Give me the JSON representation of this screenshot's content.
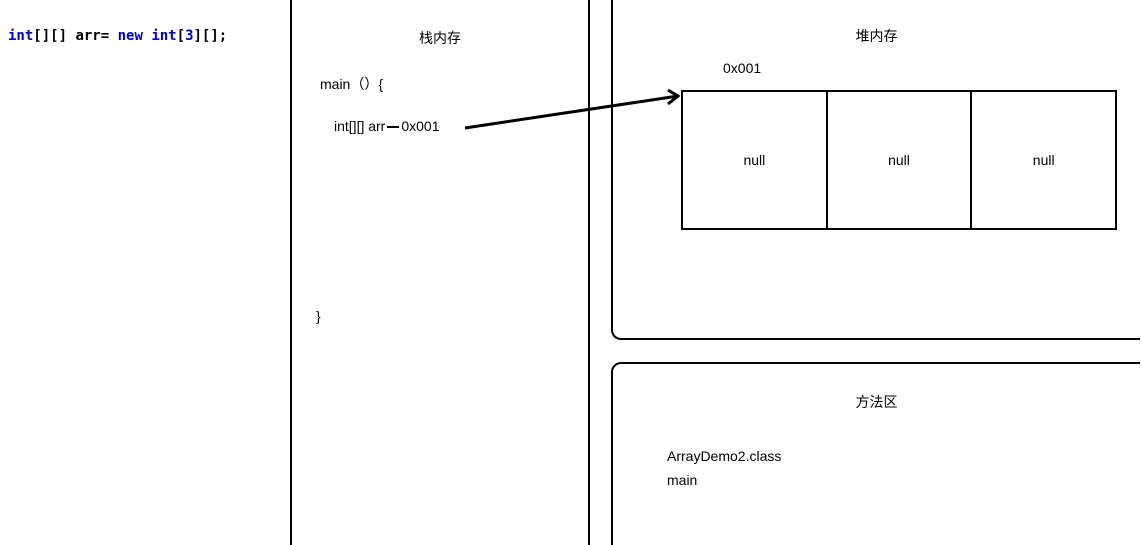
{
  "code": {
    "kw1": "int",
    "brackets1": "[][] ",
    "varname": "arr= ",
    "kw2": "new int",
    "bracket_open": "[",
    "size": "3",
    "bracket_close": "][];"
  },
  "stack": {
    "title": "栈内存",
    "main_open": "main（）{",
    "arr_text": "int[][] arr",
    "arr_addr": "0x001",
    "main_close": "}"
  },
  "heap": {
    "title": "堆内存",
    "address": "0x001",
    "cells": [
      "null",
      "null",
      "null"
    ]
  },
  "method": {
    "title": "方法区",
    "line1": "ArrayDemo2.class",
    "line2": "main"
  }
}
